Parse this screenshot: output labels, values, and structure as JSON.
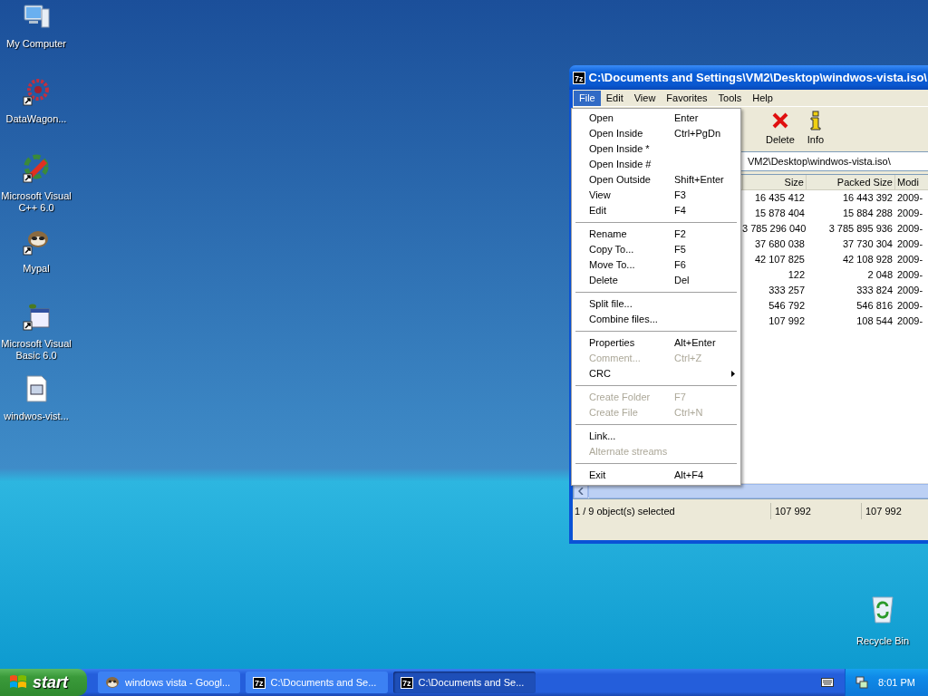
{
  "desktop_icons": [
    {
      "label": "My Computer",
      "kind": "computer"
    },
    {
      "label": "DataWagon...",
      "kind": "gear"
    },
    {
      "label": "Microsoft Visual C++ 6.0",
      "kind": "vcpp"
    },
    {
      "label": "Mypal",
      "kind": "raccoon"
    },
    {
      "label": "Microsoft Visual Basic 6.0",
      "kind": "vb"
    },
    {
      "label": "windwos-vist...",
      "kind": "file"
    }
  ],
  "recycle_bin": {
    "label": "Recycle Bin"
  },
  "window": {
    "icon_text": "7z",
    "title": "C:\\Documents and Settings\\VM2\\Desktop\\windwos-vista.iso\\",
    "menu": [
      {
        "label": "File",
        "selected": true
      },
      {
        "label": "Edit",
        "selected": false
      },
      {
        "label": "View",
        "selected": false
      },
      {
        "label": "Favorites",
        "selected": false
      },
      {
        "label": "Tools",
        "selected": false
      },
      {
        "label": "Help",
        "selected": false
      }
    ],
    "toolbar": [
      {
        "label": "Delete",
        "kind": "delete"
      },
      {
        "label": "Info",
        "kind": "info"
      }
    ],
    "address": "VM2\\Desktop\\windwos-vista.iso\\",
    "columns": [
      "Size",
      "Packed Size",
      "Modi"
    ],
    "rows": [
      {
        "size": "16 435 412",
        "packed_size": "16 443 392",
        "modified": "2009-"
      },
      {
        "size": "15 878 404",
        "packed_size": "15 884 288",
        "modified": "2009-"
      },
      {
        "size": "3 785 296 040",
        "packed_size": "3 785 895 936",
        "modified": "2009-"
      },
      {
        "size": "37 680 038",
        "packed_size": "37 730 304",
        "modified": "2009-"
      },
      {
        "size": "42 107 825",
        "packed_size": "42 108 928",
        "modified": "2009-"
      },
      {
        "size": "122",
        "packed_size": "2 048",
        "modified": "2009-"
      },
      {
        "size": "333 257",
        "packed_size": "333 824",
        "modified": "2009-"
      },
      {
        "size": "546 792",
        "packed_size": "546 816",
        "modified": "2009-"
      },
      {
        "size": "107 992",
        "packed_size": "108 544",
        "modified": "2009-"
      }
    ],
    "status_bar": [
      "1 / 9 object(s) selected",
      "107 992",
      "107 992"
    ]
  },
  "file_menu": [
    {
      "kind": "item",
      "label": "Open",
      "shortcut": "Enter",
      "disabled": false,
      "submenu": false
    },
    {
      "kind": "item",
      "label": "Open Inside",
      "shortcut": "Ctrl+PgDn",
      "disabled": false,
      "submenu": false
    },
    {
      "kind": "item",
      "label": "Open Inside *",
      "disabled": false,
      "submenu": false
    },
    {
      "kind": "item",
      "label": "Open Inside #",
      "disabled": false,
      "submenu": false
    },
    {
      "kind": "item",
      "label": "Open Outside",
      "shortcut": "Shift+Enter",
      "disabled": false,
      "submenu": false
    },
    {
      "kind": "item",
      "label": "View",
      "shortcut": "F3",
      "disabled": false,
      "submenu": false
    },
    {
      "kind": "item",
      "label": "Edit",
      "shortcut": "F4",
      "disabled": false,
      "submenu": false
    },
    {
      "kind": "separator"
    },
    {
      "kind": "item",
      "label": "Rename",
      "shortcut": "F2",
      "disabled": false,
      "submenu": false
    },
    {
      "kind": "item",
      "label": "Copy To...",
      "shortcut": "F5",
      "disabled": false,
      "submenu": false
    },
    {
      "kind": "item",
      "label": "Move To...",
      "shortcut": "F6",
      "disabled": false,
      "submenu": false
    },
    {
      "kind": "item",
      "label": "Delete",
      "shortcut": "Del",
      "disabled": false,
      "submenu": false
    },
    {
      "kind": "separator"
    },
    {
      "kind": "item",
      "label": "Split file...",
      "disabled": false,
      "submenu": false
    },
    {
      "kind": "item",
      "label": "Combine files...",
      "disabled": false,
      "submenu": false
    },
    {
      "kind": "separator"
    },
    {
      "kind": "item",
      "label": "Properties",
      "shortcut": "Alt+Enter",
      "disabled": false,
      "submenu": false
    },
    {
      "kind": "item",
      "label": "Comment...",
      "shortcut": "Ctrl+Z",
      "disabled": true,
      "submenu": false
    },
    {
      "kind": "item",
      "label": "CRC",
      "disabled": false,
      "submenu": true
    },
    {
      "kind": "separator"
    },
    {
      "kind": "item",
      "label": "Create Folder",
      "shortcut": "F7",
      "disabled": true,
      "submenu": false
    },
    {
      "kind": "item",
      "label": "Create File",
      "shortcut": "Ctrl+N",
      "disabled": true,
      "submenu": false
    },
    {
      "kind": "separator"
    },
    {
      "kind": "item",
      "label": "Link...",
      "disabled": false,
      "submenu": false
    },
    {
      "kind": "item",
      "label": "Alternate streams",
      "disabled": true,
      "submenu": false
    },
    {
      "kind": "separator"
    },
    {
      "kind": "item",
      "label": "Exit",
      "shortcut": "Alt+F4",
      "disabled": false,
      "submenu": false
    }
  ],
  "taskbar": {
    "start": "start",
    "tasks": [
      {
        "label": "windows vista - Googl...",
        "kind": "browser",
        "selected": false
      },
      {
        "label": "C:\\Documents and Se...",
        "kind": "archiver",
        "icon_text": "7z",
        "selected": false
      },
      {
        "label": "C:\\Documents and Se...",
        "kind": "archiver",
        "icon_text": "7z",
        "selected": true
      }
    ],
    "clock": "8:01 PM"
  }
}
